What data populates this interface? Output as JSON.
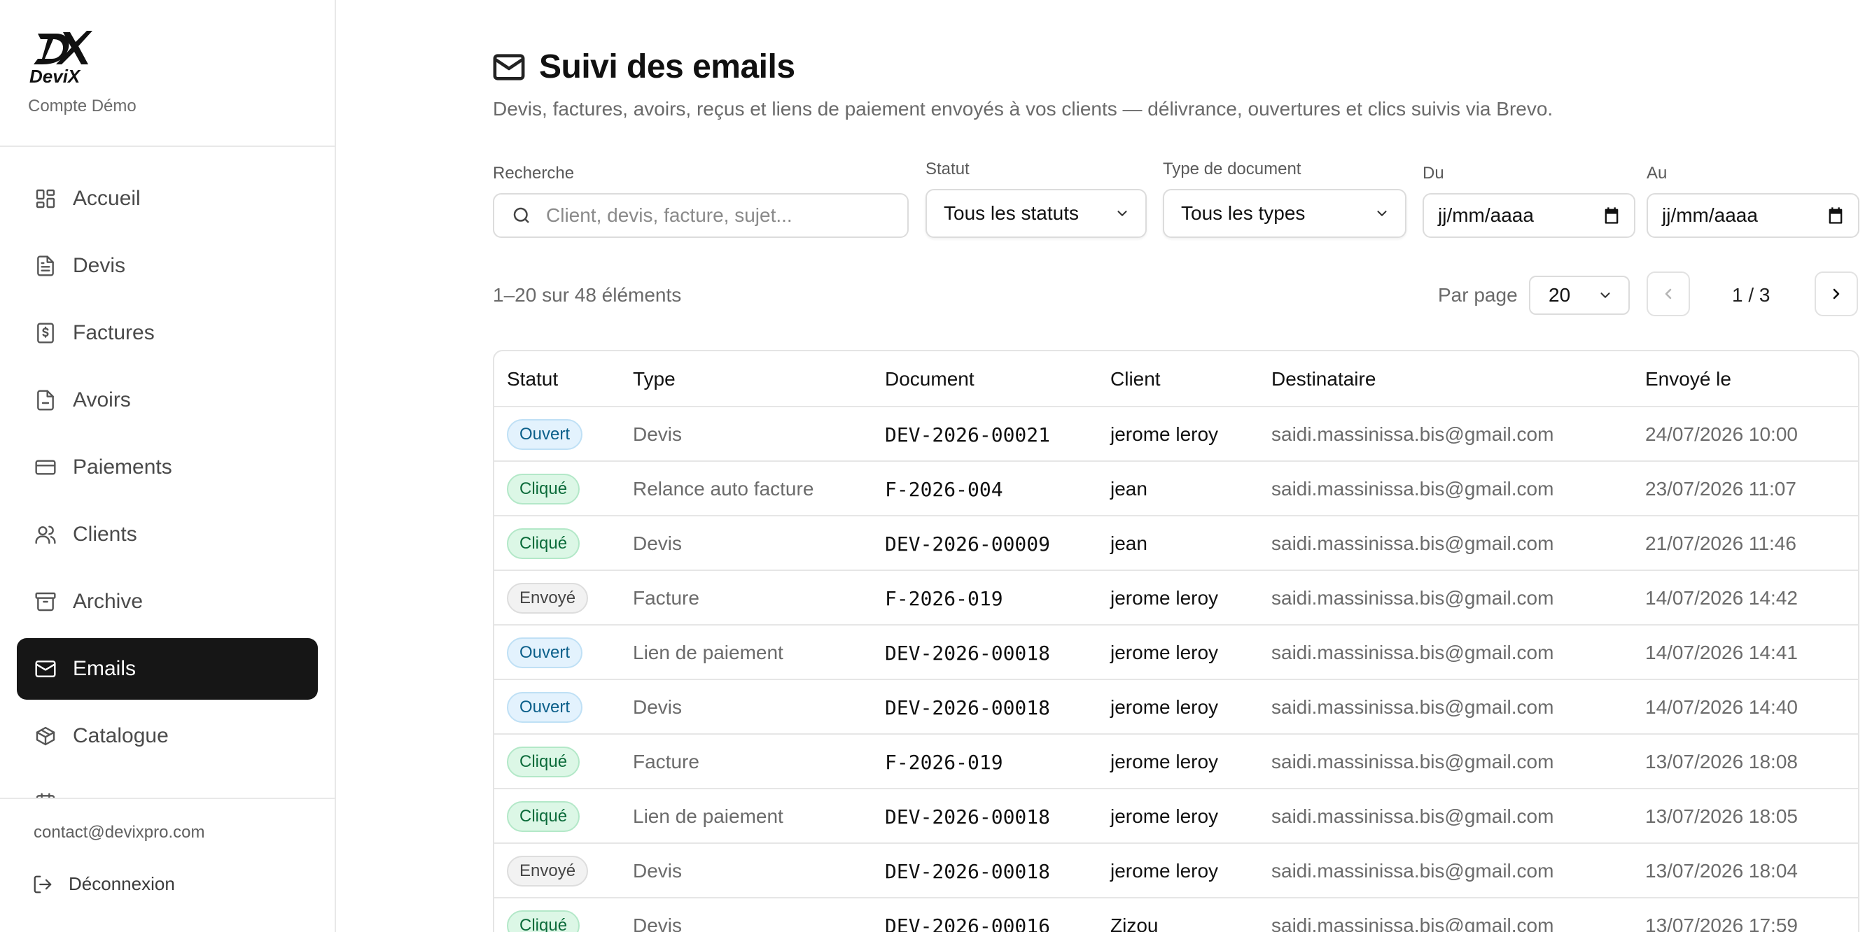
{
  "brand": {
    "logo_text": "DeviX",
    "account": "Compte Démo"
  },
  "nav": [
    {
      "label": "Accueil",
      "icon": "dashboard-icon",
      "active": false
    },
    {
      "label": "Devis",
      "icon": "document-icon",
      "active": false
    },
    {
      "label": "Factures",
      "icon": "invoice-icon",
      "active": false
    },
    {
      "label": "Avoirs",
      "icon": "credit-note-icon",
      "active": false
    },
    {
      "label": "Paiements",
      "icon": "credit-card-icon",
      "active": false
    },
    {
      "label": "Clients",
      "icon": "users-icon",
      "active": false
    },
    {
      "label": "Archive",
      "icon": "archive-icon",
      "active": false
    },
    {
      "label": "Emails",
      "icon": "mail-icon",
      "active": true
    },
    {
      "label": "Catalogue",
      "icon": "package-icon",
      "active": false
    },
    {
      "label": "",
      "icon": "calendar-icon",
      "active": false
    }
  ],
  "footer": {
    "contact": "contact@devixpro.com",
    "logout": "Déconnexion"
  },
  "page": {
    "title": "Suivi des emails",
    "subtitle": "Devis, factures, avoirs, reçus et liens de paiement envoyés à vos clients — délivrance, ouvertures et clics suivis via Brevo."
  },
  "filters": {
    "search_label": "Recherche",
    "search_placeholder": "Client, devis, facture, sujet...",
    "status_label": "Statut",
    "status_value": "Tous les statuts",
    "type_label": "Type de document",
    "type_value": "Tous les types",
    "from_label": "Du",
    "from_value": "jj/mm/aaaa",
    "to_label": "Au",
    "to_value": "jj/mm/aaaa"
  },
  "pagination": {
    "count": "1–20 sur 48 éléments",
    "per_page_label": "Par page",
    "per_page_value": "20",
    "page_info": "1 / 3"
  },
  "table": {
    "headers": {
      "status": "Statut",
      "type": "Type",
      "document": "Document",
      "client": "Client",
      "recipient": "Destinataire",
      "sent": "Envoyé le"
    },
    "rows": [
      {
        "status": "Ouvert",
        "status_kind": "ouvert",
        "type": "Devis",
        "document": "DEV-2026-00021",
        "client": "jerome leroy",
        "recipient": "saidi.massinissa.bis@gmail.com",
        "sent": "24/07/2026 10:00"
      },
      {
        "status": "Cliqué",
        "status_kind": "clique",
        "type": "Relance auto facture",
        "document": "F-2026-004",
        "client": "jean",
        "recipient": "saidi.massinissa.bis@gmail.com",
        "sent": "23/07/2026 11:07"
      },
      {
        "status": "Cliqué",
        "status_kind": "clique",
        "type": "Devis",
        "document": "DEV-2026-00009",
        "client": "jean",
        "recipient": "saidi.massinissa.bis@gmail.com",
        "sent": "21/07/2026 11:46"
      },
      {
        "status": "Envoyé",
        "status_kind": "envoye",
        "type": "Facture",
        "document": "F-2026-019",
        "client": "jerome leroy",
        "recipient": "saidi.massinissa.bis@gmail.com",
        "sent": "14/07/2026 14:42"
      },
      {
        "status": "Ouvert",
        "status_kind": "ouvert",
        "type": "Lien de paiement",
        "document": "DEV-2026-00018",
        "client": "jerome leroy",
        "recipient": "saidi.massinissa.bis@gmail.com",
        "sent": "14/07/2026 14:41"
      },
      {
        "status": "Ouvert",
        "status_kind": "ouvert",
        "type": "Devis",
        "document": "DEV-2026-00018",
        "client": "jerome leroy",
        "recipient": "saidi.massinissa.bis@gmail.com",
        "sent": "14/07/2026 14:40"
      },
      {
        "status": "Cliqué",
        "status_kind": "clique",
        "type": "Facture",
        "document": "F-2026-019",
        "client": "jerome leroy",
        "recipient": "saidi.massinissa.bis@gmail.com",
        "sent": "13/07/2026 18:08"
      },
      {
        "status": "Cliqué",
        "status_kind": "clique",
        "type": "Lien de paiement",
        "document": "DEV-2026-00018",
        "client": "jerome leroy",
        "recipient": "saidi.massinissa.bis@gmail.com",
        "sent": "13/07/2026 18:05"
      },
      {
        "status": "Envoyé",
        "status_kind": "envoye",
        "type": "Devis",
        "document": "DEV-2026-00018",
        "client": "jerome leroy",
        "recipient": "saidi.massinissa.bis@gmail.com",
        "sent": "13/07/2026 18:04"
      },
      {
        "status": "Cliqué",
        "status_kind": "clique",
        "type": "Devis",
        "document": "DEV-2026-00016",
        "client": "Zizou",
        "recipient": "saidi.massinissa.bis@gmail.com",
        "sent": "13/07/2026 17:59"
      }
    ]
  }
}
